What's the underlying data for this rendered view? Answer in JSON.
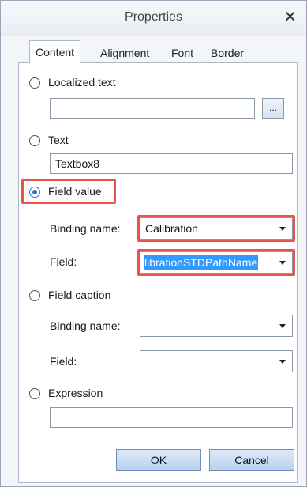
{
  "window": {
    "title": "Properties",
    "close_glyph": "✕"
  },
  "tabs": [
    {
      "label": "Content",
      "active": true
    },
    {
      "label": "Alignment",
      "active": false
    },
    {
      "label": "Font",
      "active": false
    },
    {
      "label": "Border",
      "active": false
    }
  ],
  "content": {
    "localized_text": {
      "label": "Localized text",
      "value": "",
      "browse_label": "...",
      "checked": false
    },
    "text": {
      "label": "Text",
      "value": "Textbox8",
      "checked": false
    },
    "field_value": {
      "label": "Field value",
      "checked": true,
      "binding_label": "Binding name:",
      "binding_value": "Calibration",
      "field_label": "Field:",
      "field_value": "librationSTDPathName"
    },
    "field_caption": {
      "label": "Field caption",
      "checked": false,
      "binding_label": "Binding name:",
      "binding_value": "",
      "field_label": "Field:",
      "field_value": ""
    },
    "expression": {
      "label": "Expression",
      "value": "",
      "checked": false
    }
  },
  "footer": {
    "ok_label": "OK",
    "cancel_label": "Cancel"
  },
  "colors": {
    "highlight": "#e8544a",
    "accent": "#2e6fd0",
    "selection": "#3399ff"
  }
}
